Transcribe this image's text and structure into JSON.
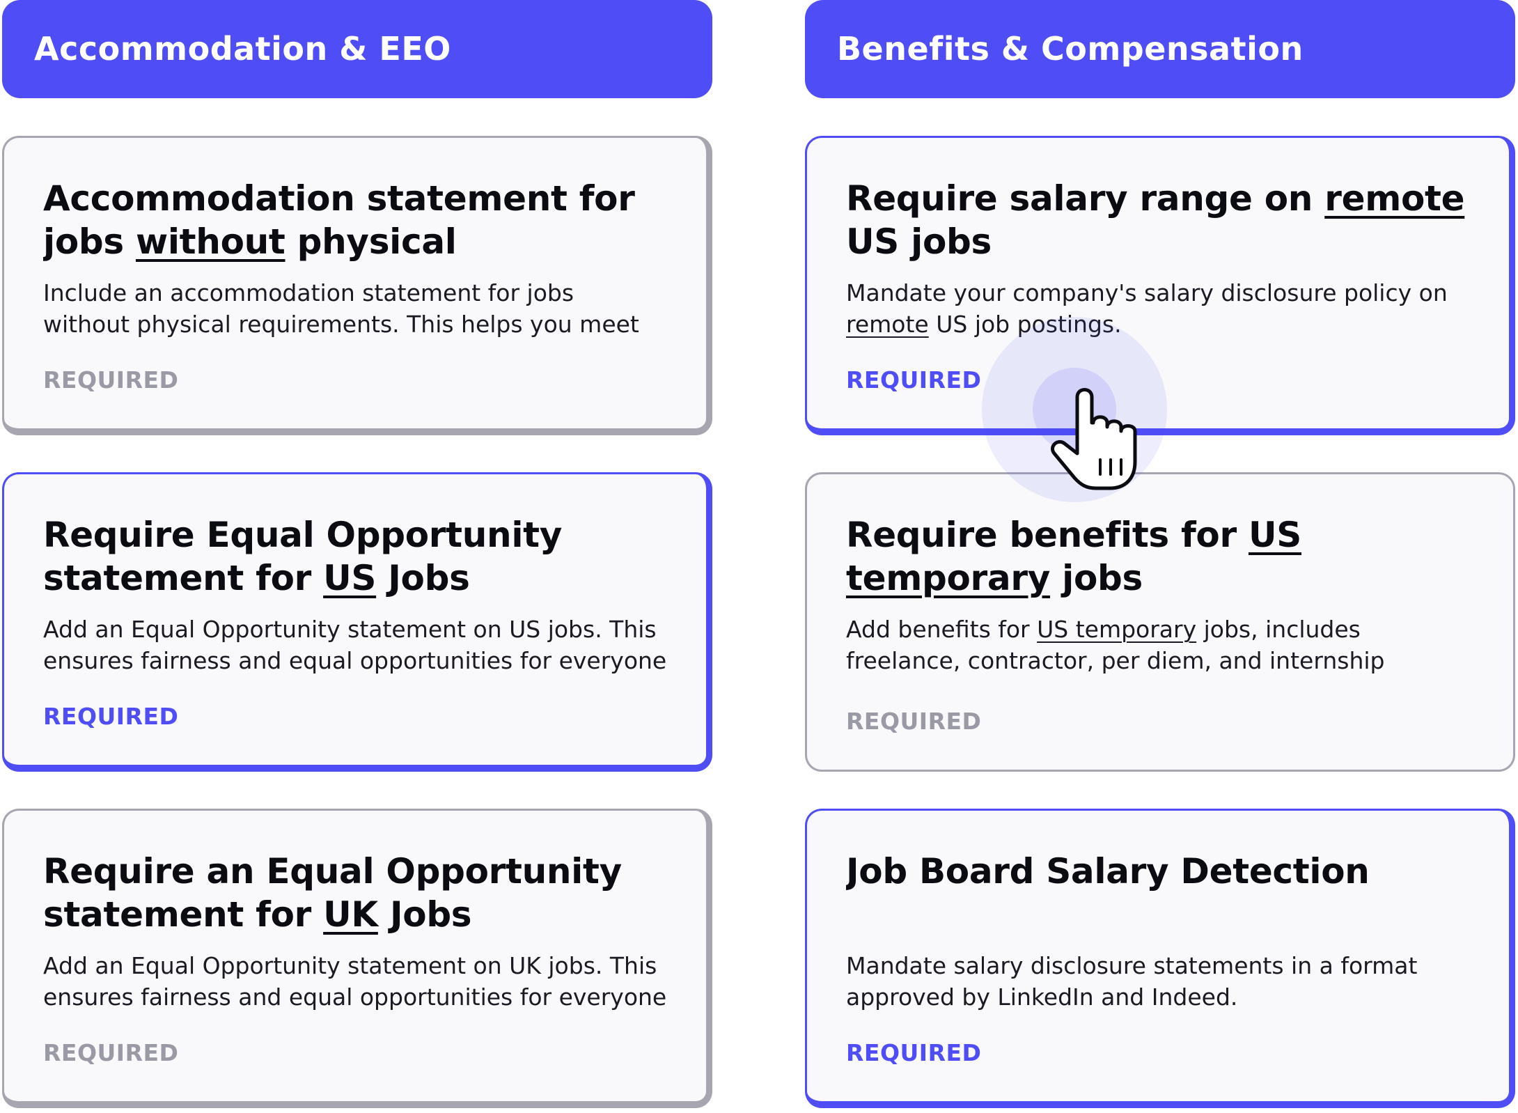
{
  "sections": [
    {
      "header": "Accommodation & EEO",
      "cards": [
        {
          "title_parts": [
            {
              "text": "Accommodation statement for jobs ",
              "u": false
            },
            {
              "text": "without",
              "u": true
            },
            {
              "text": " physical requirements",
              "u": false
            }
          ],
          "desc_parts": [
            {
              "text": "Include an accommodation statement for jobs without physical requirements. This helps you meet accessibility",
              "u": false
            }
          ],
          "badge": "REQUIRED",
          "state": "inactive"
        },
        {
          "title_parts": [
            {
              "text": "Require Equal Opportunity statement for ",
              "u": false
            },
            {
              "text": "US",
              "u": true
            },
            {
              "text": " Jobs",
              "u": false
            }
          ],
          "desc_parts": [
            {
              "text": "Add an Equal Opportunity statement on US jobs. This ensures fairness and equal opportunities for everyone",
              "u": false
            }
          ],
          "badge": "REQUIRED",
          "state": "active"
        },
        {
          "title_parts": [
            {
              "text": "Require an Equal Opportunity statement for ",
              "u": false
            },
            {
              "text": "UK",
              "u": true
            },
            {
              "text": " Jobs",
              "u": false
            }
          ],
          "desc_parts": [
            {
              "text": "Add an Equal Opportunity statement on UK jobs. This ensures fairness and equal opportunities for everyone",
              "u": false
            }
          ],
          "badge": "REQUIRED",
          "state": "inactive"
        }
      ]
    },
    {
      "header": "Benefits & Compensation",
      "cards": [
        {
          "title_parts": [
            {
              "text": "Require salary range on ",
              "u": false
            },
            {
              "text": "remote",
              "u": true
            },
            {
              "text": " US jobs",
              "u": false
            }
          ],
          "desc_parts": [
            {
              "text": "Mandate your company's salary disclosure policy on ",
              "u": false
            },
            {
              "text": "remote",
              "u": true
            },
            {
              "text": " US job postings.",
              "u": false
            }
          ],
          "badge": "REQUIRED",
          "state": "active"
        },
        {
          "title_parts": [
            {
              "text": "Require benefits for ",
              "u": false
            },
            {
              "text": "US temporary",
              "u": true
            },
            {
              "text": " jobs",
              "u": false
            }
          ],
          "desc_parts": [
            {
              "text": "Add benefits for ",
              "u": false
            },
            {
              "text": "US temporary",
              "u": true
            },
            {
              "text": " jobs, includes freelance, contractor, per diem, and internship opportunities",
              "u": false
            }
          ],
          "badge": "REQUIRED",
          "state": "plain"
        },
        {
          "title_parts": [
            {
              "text": "Job Board Salary Detection",
              "u": false
            }
          ],
          "desc_parts": [
            {
              "text": "Mandate salary disclosure statements in a format approved by LinkedIn and Indeed.",
              "u": false
            }
          ],
          "badge": "REQUIRED",
          "state": "active"
        }
      ]
    }
  ],
  "colors": {
    "accent": "#4f4df5",
    "inactive_border": "#a6a5b0",
    "badge_inactive": "#9a99a6",
    "card_bg": "#f9f9fb"
  },
  "cursor": {
    "icon": "hand-pointer-icon"
  }
}
